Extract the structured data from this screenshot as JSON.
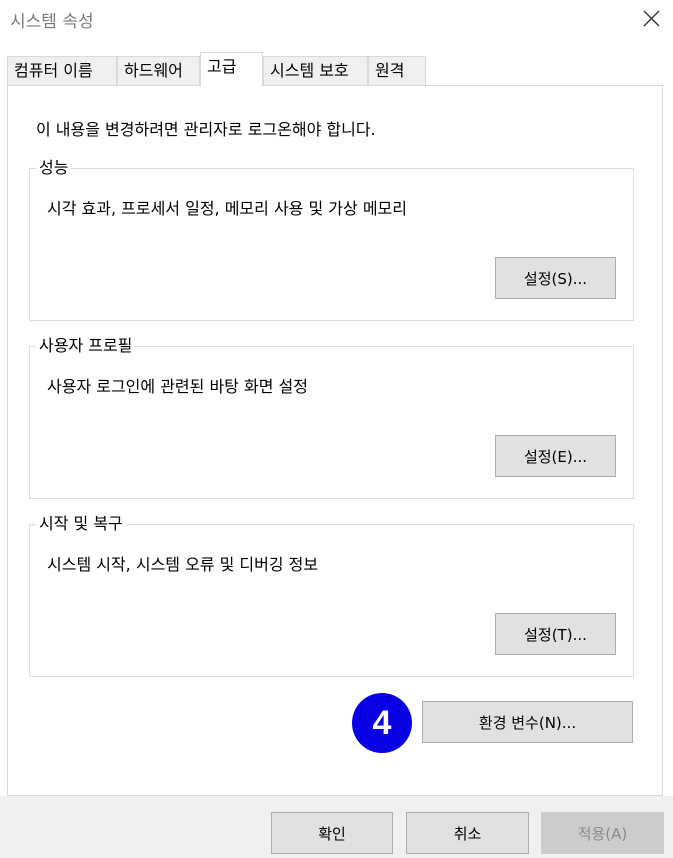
{
  "window": {
    "title": "시스템 속성"
  },
  "tabs": [
    {
      "label": "컴퓨터 이름"
    },
    {
      "label": "하드웨어"
    },
    {
      "label": "고급"
    },
    {
      "label": "시스템 보호"
    },
    {
      "label": "원격"
    }
  ],
  "active_tab": "고급",
  "admin_note": "이 내용을 변경하려면 관리자로 로그온해야 합니다.",
  "groups": [
    {
      "title": "성능",
      "description": "시각 효과, 프로세서 일정, 메모리 사용 및 가상 메모리",
      "button": "설정(S)..."
    },
    {
      "title": "사용자 프로필",
      "description": "사용자 로그인에 관련된 바탕 화면 설정",
      "button": "설정(E)..."
    },
    {
      "title": "시작 및 복구",
      "description": "시스템 시작, 시스템 오류 및 디버깅 정보",
      "button": "설정(T)..."
    }
  ],
  "env_button": "환경 변수(N)...",
  "step_badge": "4",
  "step_badge_color": "#0a00e6",
  "footer": {
    "ok": "확인",
    "cancel": "취소",
    "apply": "적용(A)"
  }
}
